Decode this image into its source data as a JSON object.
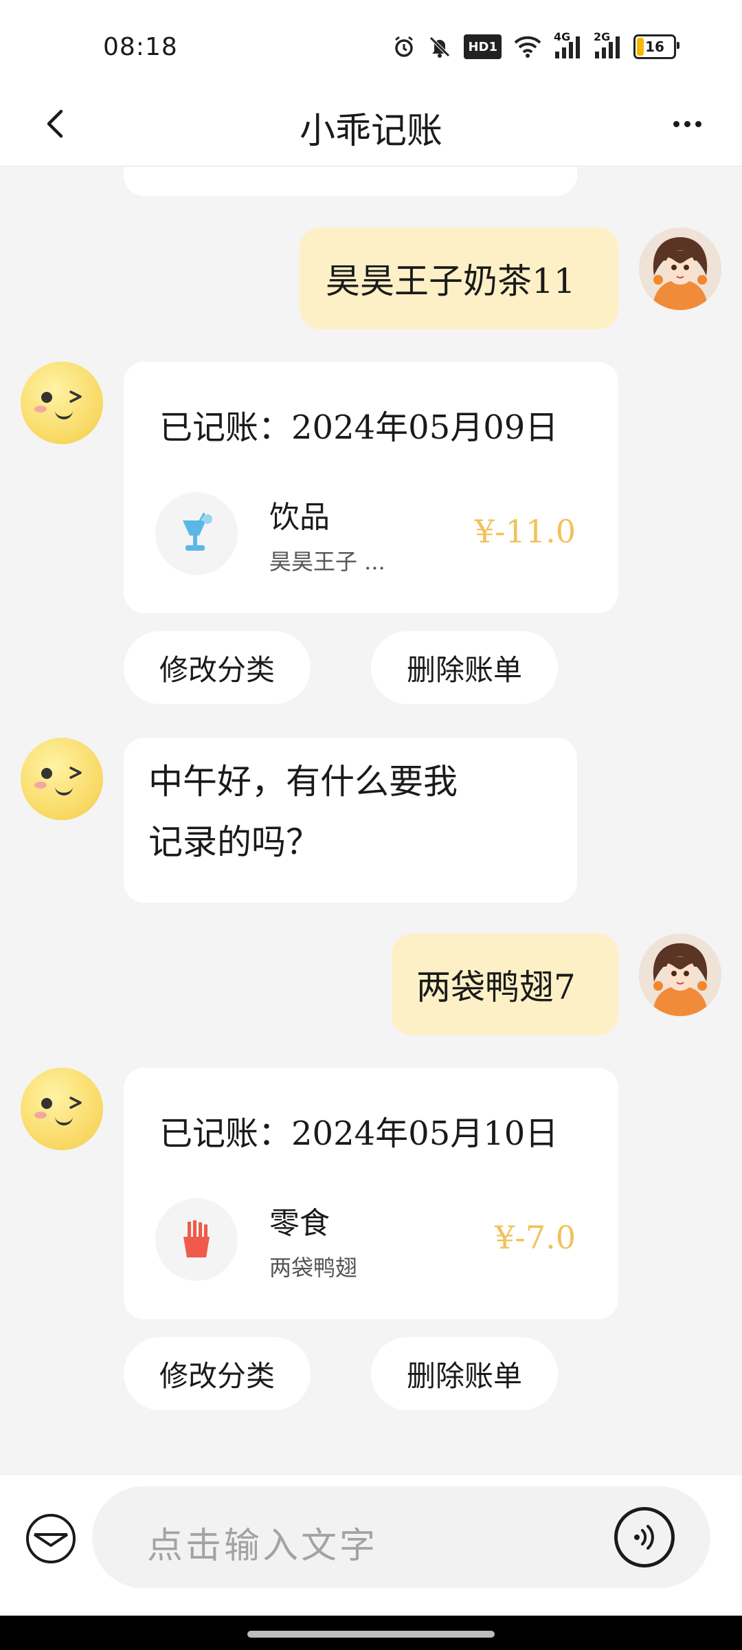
{
  "status_bar": {
    "time": "08:18",
    "hd_label": "HD1",
    "net_4g": "4G",
    "net_2g": "2G",
    "battery": "16",
    "icons": [
      "alarm-icon",
      "mute-icon",
      "hd-icon",
      "wifi-icon",
      "signal-4g-icon",
      "signal-2g-icon",
      "battery-icon"
    ]
  },
  "nav": {
    "title": "小乖记账",
    "back_icon": "back-chevron-icon",
    "more_icon": "more-dots-icon"
  },
  "messages": [
    {
      "type": "user_text",
      "text": "昊昊王子奶茶11"
    },
    {
      "type": "record",
      "title": "已记账：2024年05月09日",
      "category": "饮品",
      "note": "昊昊王子 ...",
      "amount": "¥-11.0",
      "icon": "drink-icon",
      "actions": [
        "修改分类",
        "删除账单"
      ]
    },
    {
      "type": "bot_text",
      "line1": "中午好，有什么要我",
      "line2": "记录的吗？"
    },
    {
      "type": "user_text",
      "text": "两袋鸭翅7"
    },
    {
      "type": "record",
      "title": "已记账：2024年05月10日",
      "category": "零食",
      "note": "两袋鸭翅",
      "amount": "¥-7.0",
      "icon": "fries-icon",
      "actions": [
        "修改分类",
        "删除账单"
      ]
    }
  ],
  "input": {
    "placeholder": "点击输入文字",
    "left_icon": "ledger-icon",
    "voice_icon": "voice-icon"
  },
  "colors": {
    "user_bubble": "#fdf0c6",
    "amount": "#f1c25a",
    "background": "#f4f4f4"
  }
}
